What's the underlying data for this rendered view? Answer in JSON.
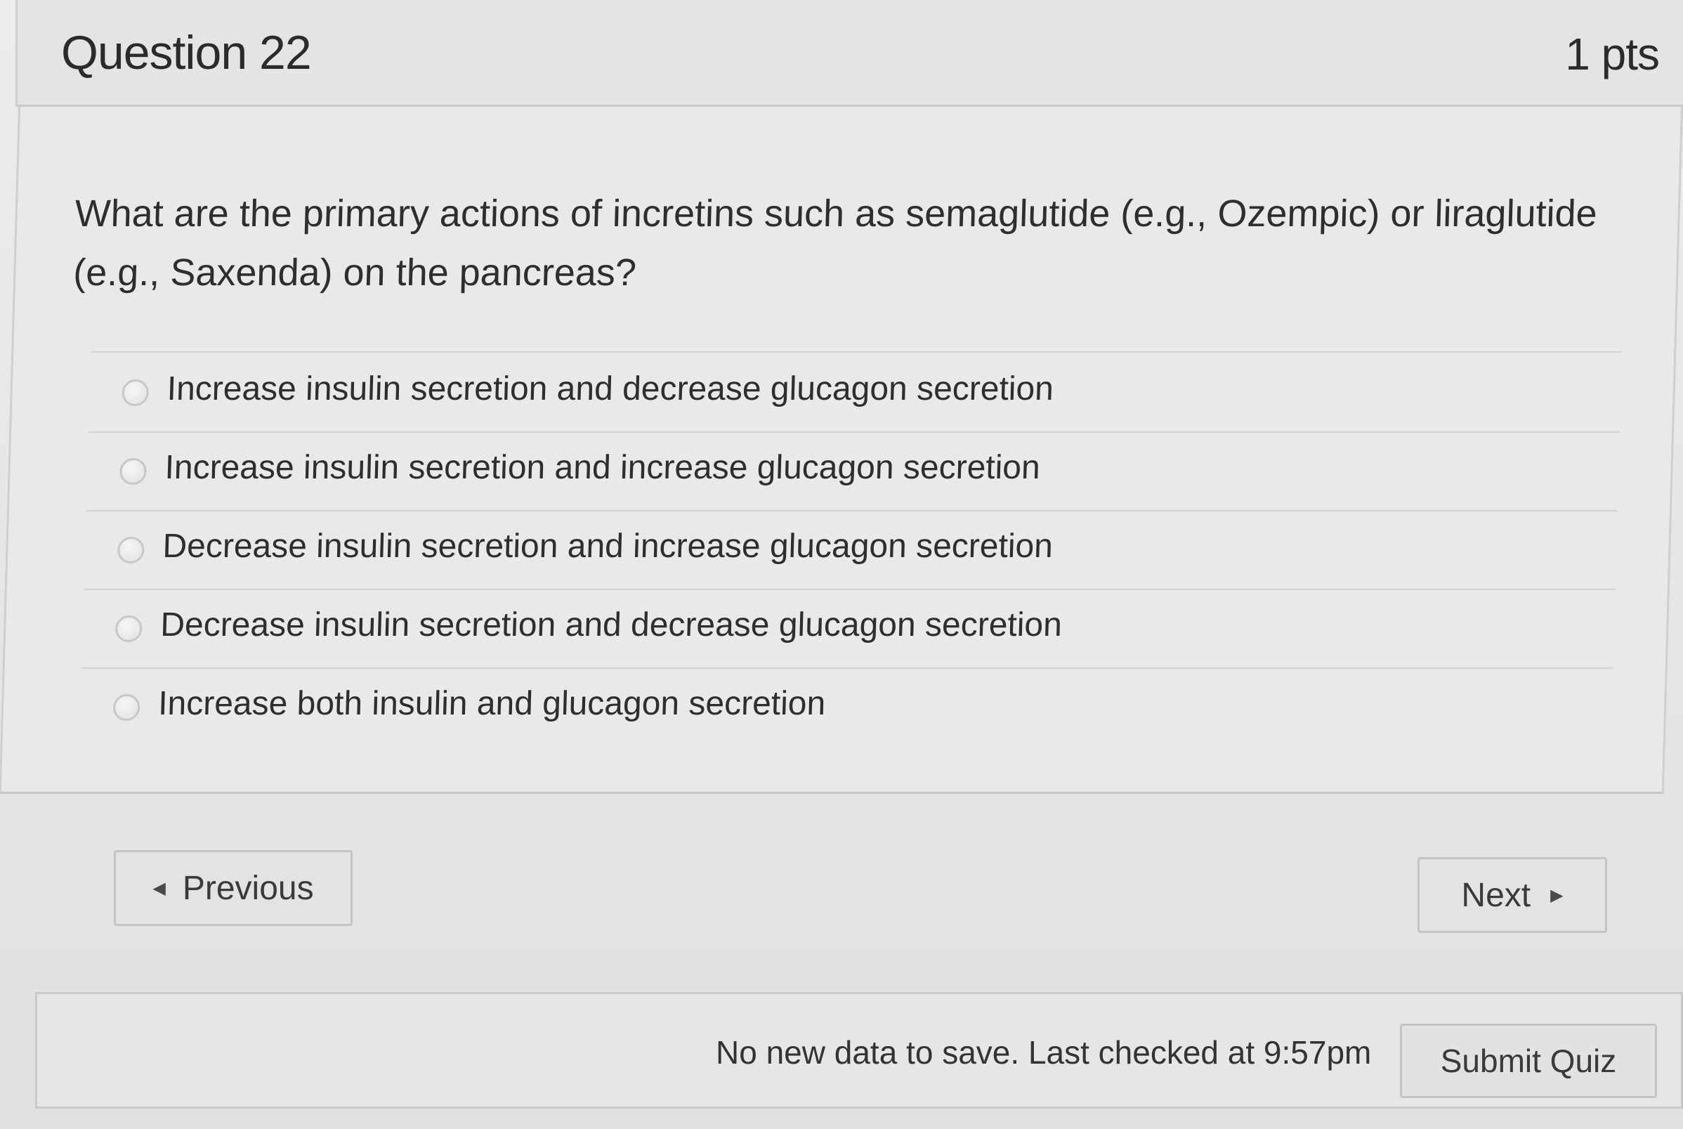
{
  "question": {
    "title": "Question 22",
    "points": "1 pts",
    "text": "What are the primary actions of incretins such as semaglutide (e.g., Ozempic) or liraglutide (e.g., Saxenda) on the pancreas?",
    "answers": [
      {
        "label": "Increase insulin secretion and decrease glucagon secretion",
        "selected": false
      },
      {
        "label": "Increase insulin secretion and increase glucagon secretion",
        "selected": false
      },
      {
        "label": "Decrease insulin secretion and increase glucagon secretion",
        "selected": false
      },
      {
        "label": "Decrease insulin secretion and decrease glucagon secretion",
        "selected": false
      },
      {
        "label": "Increase both insulin and glucagon secretion",
        "selected": false
      }
    ]
  },
  "navigation": {
    "previous_label": "Previous",
    "next_label": "Next",
    "previous_icon": "triangle-left-icon",
    "next_icon": "triangle-right-icon"
  },
  "footer": {
    "save_status": "No new data to save. Last checked at 9:57pm",
    "submit_label": "Submit Quiz"
  }
}
